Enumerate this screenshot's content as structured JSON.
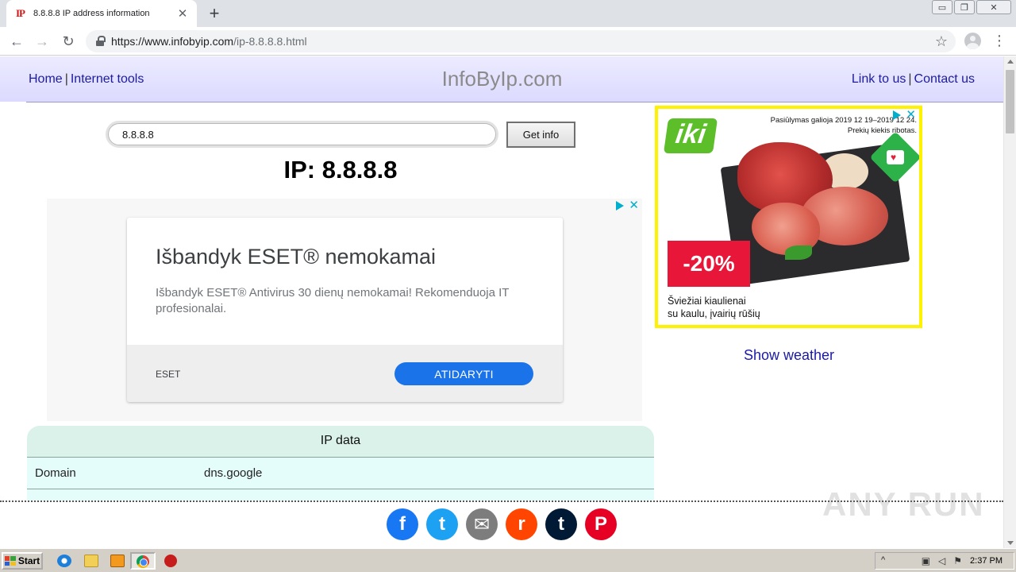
{
  "browser": {
    "tab_favicon": "IP",
    "tab_title": "8.8.8.8 IP address information",
    "tab_close": "✕",
    "new_tab": "+",
    "url_host": "https://www.infobyip.com",
    "url_path": "/ip-8.8.8.8.html",
    "win_minimize": "▭",
    "win_restore": "❐",
    "win_close": "✕",
    "back": "←",
    "forward": "→",
    "reload": "↻",
    "star": "☆",
    "menu": "⋮"
  },
  "header": {
    "nav_left": [
      {
        "label": "Home"
      },
      {
        "label": "Internet tools"
      }
    ],
    "nav_left_sep": "|",
    "site_title": "InfoByIp.com",
    "nav_right": [
      {
        "label": "Link to us"
      },
      {
        "label": "Contact us"
      }
    ],
    "nav_right_sep": "|"
  },
  "search": {
    "value": "8.8.8.8",
    "button_label": "Get info"
  },
  "ip_heading": "IP: 8.8.8.8",
  "ad_eset": {
    "title": "Išbandyk ESET® nemokamai",
    "description": "Išbandyk ESET® Antivirus 30 dienų nemokamai! Rekomenduoja IT profesionalai.",
    "brand": "ESET",
    "cta": "ATIDARYTI",
    "close": "✕"
  },
  "ip_table": {
    "header": "IP data",
    "rows": [
      {
        "key": "Domain",
        "value": "dns.google"
      }
    ]
  },
  "ad_iki": {
    "logo": "iki",
    "promo_line1": "Pasiūlymas galioja 2019 12 19–2019 12 24.",
    "promo_line2": "Prekių kiekis ribotas.",
    "badge": "♥",
    "discount": "-20%",
    "caption_line1": "Šviežiai kiaulienai",
    "caption_line2": "su kaulu, įvairių rūšių",
    "close": "✕",
    "border_color": "#fff200",
    "accent_color": "#e8173a"
  },
  "show_weather": "Show weather",
  "share": {
    "icons": [
      {
        "name": "facebook-icon",
        "glyph": "f",
        "color": "#1877f2"
      },
      {
        "name": "twitter-icon",
        "glyph": "t",
        "color": "#1da1f2"
      },
      {
        "name": "email-icon",
        "glyph": "✉",
        "color": "#7d7d7d"
      },
      {
        "name": "reddit-icon",
        "glyph": "r",
        "color": "#ff4500"
      },
      {
        "name": "tumblr-icon",
        "glyph": "t",
        "color": "#001935"
      },
      {
        "name": "pinterest-icon",
        "glyph": "P",
        "color": "#e60023"
      }
    ]
  },
  "watermark": "ANY RUN",
  "taskbar": {
    "start_label": "Start",
    "tray_expand": "^",
    "clock": "2:37 PM"
  }
}
